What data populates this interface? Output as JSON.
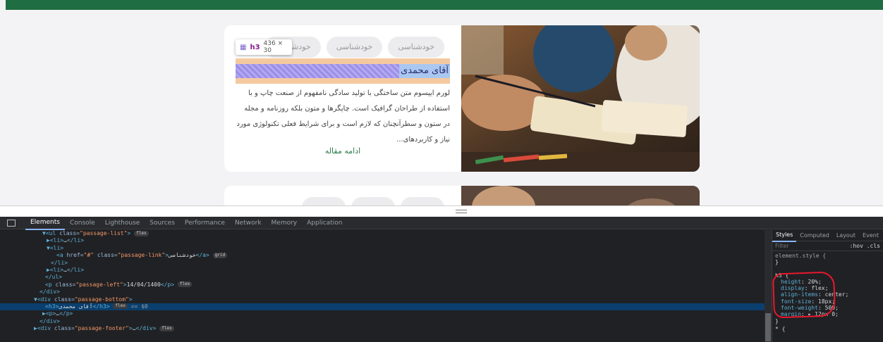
{
  "site": {
    "cards": [
      {
        "tags": [
          "خودشناسی",
          "خودشناسی",
          "خودشناسی"
        ],
        "title": "آقای محمدی",
        "excerpt": "لورم ایپسوم متن ساختگی با تولید سادگی نامفهوم از صنعت چاپ و با استفاده از طراحان گرافیک است. چاپگرها و متون بلکه روزنامه و مجله در ستون و سطرآنچنان که لازم است و برای شرایط فعلی تکنولوژی مورد نیاز و کاربردهای...",
        "read_more": "ادامه مقاله"
      }
    ],
    "inspect_tooltip": {
      "tag": "h3",
      "dims": "436 × 30"
    },
    "colors": {
      "brand": "#1f6d42",
      "link": "#2a7a4b"
    }
  },
  "devtools": {
    "tabs": [
      "Elements",
      "Console",
      "Lighthouse",
      "Sources",
      "Performance",
      "Network",
      "Memory",
      "Application"
    ],
    "active_tab": "Elements",
    "dom_lines": [
      {
        "parts": [
          [
            "tagc",
            "▼<ul "
          ],
          [
            "attr",
            "class="
          ],
          [
            "val",
            "\"passage-list\""
          ],
          [
            "tagc",
            ">"
          ]
        ],
        "badge": "flex",
        "indent": 60
      },
      {
        "parts": [
          [
            "tagc",
            "▶<li>"
          ],
          [
            "txt",
            "…"
          ],
          [
            "tagc",
            "</li>"
          ]
        ],
        "indent": 66
      },
      {
        "parts": [
          [
            "tagc",
            "▼<li>"
          ]
        ],
        "indent": 66
      },
      {
        "parts": [
          [
            "tagc",
            "<a "
          ],
          [
            "attr",
            "href="
          ],
          [
            "val",
            "\"#\""
          ],
          [
            "attr",
            " class="
          ],
          [
            "val",
            "\"passage-link\""
          ],
          [
            "tagc",
            ">"
          ],
          [
            "txt",
            "خودشناسی"
          ],
          [
            "tagc",
            "</a>"
          ]
        ],
        "badge": "grid",
        "indent": 80
      },
      {
        "parts": [
          [
            "tagc",
            "</li>"
          ]
        ],
        "indent": 72
      },
      {
        "parts": [
          [
            "tagc",
            "▶<li>"
          ],
          [
            "txt",
            "…"
          ],
          [
            "tagc",
            "</li>"
          ]
        ],
        "indent": 66
      },
      {
        "parts": [
          [
            "tagc",
            "</ul>"
          ]
        ],
        "indent": 64
      },
      {
        "parts": [
          [
            "tagc",
            "<p "
          ],
          [
            "attr",
            "class="
          ],
          [
            "val",
            "\"passage-left\""
          ],
          [
            "tagc",
            ">"
          ],
          [
            "txt",
            "14/04/1400"
          ],
          [
            "tagc",
            "</p>"
          ]
        ],
        "badge": "flex",
        "indent": 64
      },
      {
        "parts": [
          [
            "tagc",
            "</div>"
          ]
        ],
        "indent": 56
      },
      {
        "parts": [
          [
            "tagc",
            "▼<div "
          ],
          [
            "attr",
            "class="
          ],
          [
            "val",
            "\"passage-bottom\""
          ],
          [
            "tagc",
            ">"
          ]
        ],
        "indent": 48
      },
      {
        "parts": [
          [
            "tagc",
            "<h3>"
          ],
          [
            "txt",
            "آقای محمدی"
          ],
          [
            "tagc",
            "</h3>"
          ]
        ],
        "badge": "flex",
        "sel_mark": "== $0",
        "indent": 64,
        "selected": true
      },
      {
        "parts": [
          [
            "tagc",
            "▶<p>"
          ],
          [
            "txt",
            "…"
          ],
          [
            "tagc",
            "</p>"
          ]
        ],
        "indent": 60
      },
      {
        "parts": [
          [
            "tagc",
            "</div>"
          ]
        ],
        "indent": 56
      },
      {
        "parts": [
          [
            "tagc",
            "▶<div "
          ],
          [
            "attr",
            "class="
          ],
          [
            "val",
            "\"passage-footer\""
          ],
          [
            "tagc",
            ">"
          ],
          [
            "txt",
            "…"
          ],
          [
            "tagc",
            "</div>"
          ]
        ],
        "badge": "flex",
        "indent": 48
      }
    ],
    "styles_pane": {
      "tabs": [
        "Styles",
        "Computed",
        "Layout",
        "Event"
      ],
      "active_tab": "Styles",
      "filter_placeholder": "Filter",
      "hov_cls": ":hov .cls",
      "element_style": "element.style {",
      "rule_selector": "h3 {",
      "declarations": [
        {
          "name": "height",
          "value": "20%;"
        },
        {
          "name": "display",
          "value": "flex;"
        },
        {
          "name": "align-items",
          "value": "center;"
        },
        {
          "name": "font-size",
          "value": "18px;"
        },
        {
          "name": "font-weight",
          "value": "500;"
        },
        {
          "name": "margin",
          "value": "▸ 12px 0;"
        }
      ],
      "close_brace": "}",
      "next_rule": "* {"
    },
    "colors": {
      "annotation": "#e8182e",
      "selection": "#0a3f6e"
    }
  }
}
